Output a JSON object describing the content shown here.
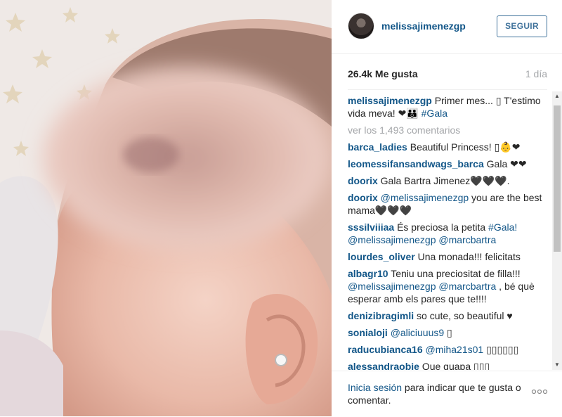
{
  "photo": {
    "alt_subject": "baby-photo"
  },
  "header": {
    "username": "melissajimenezgp",
    "follow_label": "SEGUIR"
  },
  "meta": {
    "likes": "26.4k Me gusta",
    "time": "1 día"
  },
  "caption": {
    "user": "melissajimenezgp",
    "text": "Primer mes... ▯ T'estimo vida meva! ❤︎👪 ",
    "tag": "#Gala"
  },
  "load_more": "ver los 1,493 comentarios",
  "comments": [
    {
      "user": "barca_ladies",
      "text": "Beautiful Princess! ▯👶❤"
    },
    {
      "user": "leomessifansandwags_barca",
      "text": "Gala ❤❤"
    },
    {
      "user": "doorix",
      "text": "Gala Bartra Jimenez🖤🖤🖤."
    },
    {
      "user": "doorix",
      "tags": [
        "@melissajimenezgp"
      ],
      "text": " you are the best mama🖤🖤🖤"
    },
    {
      "user": "sssilviiiaa",
      "text": "És preciosa la petita ",
      "tags": [
        "#Gala!",
        "@melissajimenezgp",
        "@marcbartra"
      ]
    },
    {
      "user": "lourdes_oliver",
      "text": "Una monada!!! felicitats"
    },
    {
      "user": "albagr10",
      "text": "Teniu una preciositat de filla!!! ",
      "tags": [
        "@melissajimenezgp",
        "@marcbartra"
      ],
      "text2": " , bé què esperar amb els pares que te!!!!"
    },
    {
      "user": "denizibragimli",
      "text": "so cute, so beautiful ♥"
    },
    {
      "user": "sonialoji",
      "tags": [
        "@aliciuuus9"
      ],
      "text": " ▯"
    },
    {
      "user": "raducubianca16",
      "tags": [
        "@miha21s01"
      ],
      "text": " ▯▯▯▯▯▯"
    },
    {
      "user": "alessandraobie",
      "text": " Que guapa ▯▯▯"
    }
  ],
  "footer": {
    "login_link": "Inicia sesión",
    "login_rest": " para indicar que te gusta o comentar."
  },
  "icons": {
    "more": "more-options-icon",
    "scroll_up": "scroll-up-arrow-icon",
    "scroll_down": "scroll-down-arrow-icon"
  },
  "colors": {
    "link": "#125688",
    "button": "#3f729b",
    "muted": "#a5a7aa",
    "text": "#262626"
  }
}
